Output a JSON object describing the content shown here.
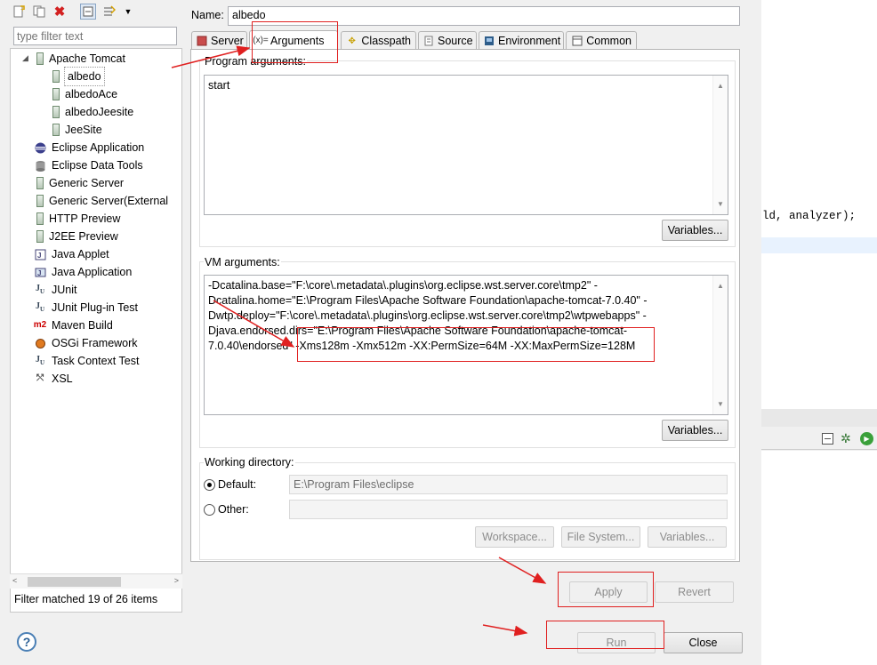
{
  "toolbar": {
    "icons": [
      "new-launch-config-icon",
      "duplicate-icon",
      "delete-icon",
      "collapse-all-icon",
      "filter-icon",
      "view-menu-icon"
    ]
  },
  "filter": {
    "placeholder": "type filter text"
  },
  "tree": {
    "items": [
      {
        "label": "Apache Tomcat",
        "icon": "tomcat-icon"
      },
      {
        "label": "albedo",
        "icon": "tomcat-icon",
        "selected": true
      },
      {
        "label": "albedoAce",
        "icon": "tomcat-icon"
      },
      {
        "label": "albedoJeesite",
        "icon": "tomcat-icon"
      },
      {
        "label": "JeeSite",
        "icon": "tomcat-icon"
      },
      {
        "label": "Eclipse Application",
        "icon": "eclipse-icon"
      },
      {
        "label": "Eclipse Data Tools",
        "icon": "database-icon"
      },
      {
        "label": "Generic Server",
        "icon": "server-icon"
      },
      {
        "label": "Generic Server(External",
        "icon": "server-icon"
      },
      {
        "label": "HTTP Preview",
        "icon": "server-icon"
      },
      {
        "label": "J2EE Preview",
        "icon": "server-icon"
      },
      {
        "label": "Java Applet",
        "icon": "applet-icon"
      },
      {
        "label": "Java Application",
        "icon": "java-app-icon"
      },
      {
        "label": "JUnit",
        "icon": "junit-icon"
      },
      {
        "label": "JUnit Plug-in Test",
        "icon": "junit-plugin-icon"
      },
      {
        "label": "Maven Build",
        "icon": "maven-icon"
      },
      {
        "label": "OSGi Framework",
        "icon": "osgi-icon"
      },
      {
        "label": "Task Context Test",
        "icon": "task-test-icon"
      },
      {
        "label": "XSL",
        "icon": "xsl-icon"
      }
    ],
    "status": "Filter matched 19 of 26 items"
  },
  "config": {
    "name_label": "Name:",
    "name_value": "albedo",
    "tabs": [
      {
        "label": "Server",
        "icon": "server-tab-icon"
      },
      {
        "label": "Arguments",
        "icon": "arguments-icon",
        "active": true
      },
      {
        "label": "Classpath",
        "icon": "classpath-icon"
      },
      {
        "label": "Source",
        "icon": "source-icon"
      },
      {
        "label": "Environment",
        "icon": "environment-icon"
      },
      {
        "label": "Common",
        "icon": "common-icon"
      }
    ],
    "program_args": {
      "label": "Program arguments:",
      "value": "start",
      "variables_button": "Variables..."
    },
    "vm_args": {
      "label": "VM arguments:",
      "lines": [
        "-Dcatalina.base=\"F:\\core\\.metadata\\.plugins\\org.eclipse.wst.server.core\\tmp2\" -",
        "Dcatalina.home=\"E:\\Program Files\\Apache Software Foundation\\apache-tomcat-7.0.40\" -",
        "Dwtp.deploy=\"F:\\core\\.metadata\\.plugins\\org.eclipse.wst.server.core\\tmp2\\wtpwebapps\" -",
        "Djava.endorsed.dirs=\"E:\\Program Files\\Apache Software Foundation\\apache-tomcat-"
      ],
      "last_line_start": "7.0.40\\endorsed\" ",
      "highlighted": "-Xms128m -Xmx512m -XX:PermSize=64M -XX:MaxPermSize=128M",
      "variables_button": "Variables..."
    },
    "working_dir": {
      "label": "Working directory:",
      "default_label": "Default:",
      "default_value": "E:\\Program Files\\eclipse",
      "other_label": "Other:",
      "other_value": "",
      "workspace_button": "Workspace...",
      "filesystem_button": "File System...",
      "variables_button": "Variables..."
    }
  },
  "actions": {
    "apply": "Apply",
    "revert": "Revert",
    "run": "Run",
    "close": "Close"
  },
  "editor": {
    "code_fragment": "ld, analyzer);",
    "console_icons": [
      "minimize-icon",
      "debug-icon",
      "run-icon"
    ]
  },
  "help_icon": "?",
  "colors": {
    "highlight": "#e02020",
    "selection": "#e8f2fe",
    "accent": "#4a7fb5"
  }
}
